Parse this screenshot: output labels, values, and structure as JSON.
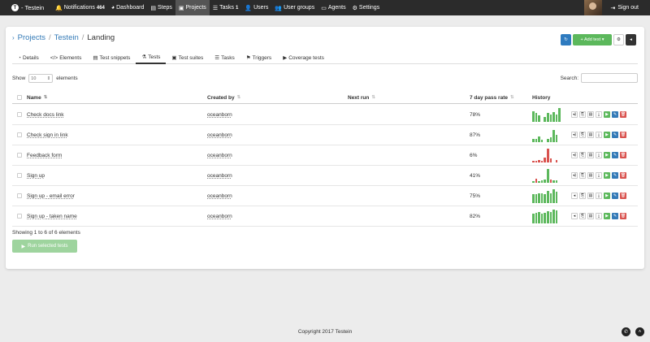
{
  "nav": {
    "brand": "- Testein",
    "items": [
      {
        "icon": "bell-icon",
        "glyph": "🔔",
        "label": "Notifications",
        "badge": "464"
      },
      {
        "icon": "dashboard-icon",
        "glyph": "◕",
        "label": "Dashboard",
        "badge": ""
      },
      {
        "icon": "steps-icon",
        "glyph": "▤",
        "label": "Steps",
        "badge": ""
      },
      {
        "icon": "briefcase-icon",
        "glyph": "▣",
        "label": "Projects",
        "badge": "",
        "active": true
      },
      {
        "icon": "tasks-icon",
        "glyph": "☰",
        "label": "Tasks",
        "badge": "1"
      },
      {
        "icon": "user-icon",
        "glyph": "👤",
        "label": "Users",
        "badge": ""
      },
      {
        "icon": "users-icon",
        "glyph": "👥",
        "label": "User groups",
        "badge": ""
      },
      {
        "icon": "monitor-icon",
        "glyph": "▭",
        "label": "Agents",
        "badge": ""
      },
      {
        "icon": "gears-icon",
        "glyph": "⚙",
        "label": "Settings",
        "badge": ""
      }
    ],
    "signout": "Sign out"
  },
  "breadcrumb": {
    "projects": "Projects",
    "project": "Testein",
    "current": "Landing"
  },
  "actions": {
    "add_label": "+ Add test"
  },
  "tabs": [
    {
      "icon": "pie-icon",
      "glyph": "◔",
      "label": "Details"
    },
    {
      "icon": "code-icon",
      "glyph": "</>",
      "label": "Elements"
    },
    {
      "icon": "snippet-icon",
      "glyph": "▤",
      "label": "Test snippets"
    },
    {
      "icon": "flask-icon",
      "glyph": "⚗",
      "label": "Tests",
      "active": true
    },
    {
      "icon": "briefcase-icon",
      "glyph": "▣",
      "label": "Test suites"
    },
    {
      "icon": "tasks-icon",
      "glyph": "☰",
      "label": "Tasks"
    },
    {
      "icon": "trigger-icon",
      "glyph": "⚑",
      "label": "Triggers"
    },
    {
      "icon": "play-icon",
      "glyph": "▶",
      "label": "Coverage tests"
    }
  ],
  "table_controls": {
    "show": "Show",
    "page_size": "10",
    "elements": "elements",
    "search_label": "Search:"
  },
  "columns": {
    "name": "Name",
    "created_by": "Created by",
    "next_run": "Next run",
    "pass_rate": "7 day pass rate",
    "history": "History"
  },
  "rows": [
    {
      "name": "Check docs link",
      "created_by": "oceanborn",
      "next_run": "",
      "pass_rate": "78%",
      "history": [
        {
          "h": 0.75,
          "c": "#5cb85c"
        },
        {
          "h": 0.6,
          "c": "#5cb85c"
        },
        {
          "h": 0.45,
          "c": "#5cb85c"
        },
        {
          "h": 0.0,
          "c": "#5cb85c"
        },
        {
          "h": 0.35,
          "c": "#5cb85c"
        },
        {
          "h": 0.6,
          "c": "#5cb85c"
        },
        {
          "h": 0.5,
          "c": "#5cb85c"
        },
        {
          "h": 0.7,
          "c": "#5cb85c"
        },
        {
          "h": 0.5,
          "c": "#5cb85c"
        },
        {
          "h": 0.95,
          "c": "#5cb85c"
        }
      ],
      "first_ctrl": "speaker-icon"
    },
    {
      "name": "Check sign in link",
      "created_by": "oceanborn",
      "next_run": "",
      "pass_rate": "87%",
      "history": [
        {
          "h": 0.2,
          "c": "#5cb85c"
        },
        {
          "h": 0.2,
          "c": "#5cb85c"
        },
        {
          "h": 0.4,
          "c": "#5cb85c"
        },
        {
          "h": 0.15,
          "c": "#5cb85c"
        },
        {
          "h": 0.0,
          "c": "#5cb85c"
        },
        {
          "h": 0.2,
          "c": "#5cb85c"
        },
        {
          "h": 0.3,
          "c": "#5cb85c"
        },
        {
          "h": 0.85,
          "c": "#5cb85c"
        },
        {
          "h": 0.5,
          "c": "#5cb85c"
        },
        {
          "h": 0.0,
          "c": "#5cb85c"
        }
      ],
      "first_ctrl": "speaker-icon"
    },
    {
      "name": "Feedback form",
      "created_by": "oceanborn",
      "next_run": "",
      "pass_rate": "6%",
      "history": [
        {
          "h": 0.1,
          "c": "#d9534f"
        },
        {
          "h": 0.1,
          "c": "#d9534f"
        },
        {
          "h": 0.15,
          "c": "#d9534f"
        },
        {
          "h": 0.1,
          "c": "#d9534f"
        },
        {
          "h": 0.35,
          "c": "#d9534f"
        },
        {
          "h": 0.95,
          "c": "#d9534f"
        },
        {
          "h": 0.25,
          "c": "#d9534f"
        },
        {
          "h": 0.0,
          "c": "#d9534f"
        },
        {
          "h": 0.15,
          "c": "#d9534f"
        },
        {
          "h": 0.0,
          "c": "#d9534f"
        }
      ],
      "first_ctrl": "speaker-icon"
    },
    {
      "name": "Sign up",
      "created_by": "oceanborn",
      "next_run": "",
      "pass_rate": "41%",
      "history": [
        {
          "h": 0.1,
          "c": "#5cb85c"
        },
        {
          "h": 0.25,
          "c": "#d9534f"
        },
        {
          "h": 0.1,
          "c": "#5cb85c"
        },
        {
          "h": 0.15,
          "c": "#5cb85c"
        },
        {
          "h": 0.2,
          "c": "#5cb85c"
        },
        {
          "h": 0.95,
          "c": "#5cb85c"
        },
        {
          "h": 0.2,
          "c": "#d9534f"
        },
        {
          "h": 0.15,
          "c": "#5cb85c"
        },
        {
          "h": 0.15,
          "c": "#5cb85c"
        },
        {
          "h": 0.0,
          "c": "#5cb85c"
        }
      ],
      "first_ctrl": "speaker-icon"
    },
    {
      "name": "Sign up - email error",
      "created_by": "oceanborn",
      "next_run": "",
      "pass_rate": "75%",
      "history": [
        {
          "h": 0.6,
          "c": "#5cb85c"
        },
        {
          "h": 0.6,
          "c": "#5cb85c"
        },
        {
          "h": 0.65,
          "c": "#5cb85c"
        },
        {
          "h": 0.7,
          "c": "#5cb85c"
        },
        {
          "h": 0.6,
          "c": "#5cb85c"
        },
        {
          "h": 0.85,
          "c": "#5cb85c"
        },
        {
          "h": 0.7,
          "c": "#5cb85c"
        },
        {
          "h": 0.95,
          "c": "#5cb85c"
        },
        {
          "h": 0.8,
          "c": "#5cb85c"
        },
        {
          "h": 0.0,
          "c": "#5cb85c"
        }
      ],
      "first_ctrl": "volume-low-icon"
    },
    {
      "name": "Sign up - taken name",
      "created_by": "oceanborn",
      "next_run": "",
      "pass_rate": "82%",
      "history": [
        {
          "h": 0.7,
          "c": "#5cb85c"
        },
        {
          "h": 0.75,
          "c": "#5cb85c"
        },
        {
          "h": 0.8,
          "c": "#5cb85c"
        },
        {
          "h": 0.7,
          "c": "#5cb85c"
        },
        {
          "h": 0.75,
          "c": "#5cb85c"
        },
        {
          "h": 0.85,
          "c": "#5cb85c"
        },
        {
          "h": 0.8,
          "c": "#5cb85c"
        },
        {
          "h": 0.95,
          "c": "#5cb85c"
        },
        {
          "h": 0.9,
          "c": "#5cb85c"
        },
        {
          "h": 0.0,
          "c": "#5cb85c"
        }
      ],
      "first_ctrl": "volume-low-icon"
    }
  ],
  "info": "Showing 1 to 6 of 6 elements",
  "run_selected": "Run selected tests",
  "footer": "Copyright 2017 Testein",
  "colors": {
    "success": "#5cb85c",
    "danger": "#d9534f",
    "primary": "#337ab7",
    "nav": "#2b2b2b"
  }
}
